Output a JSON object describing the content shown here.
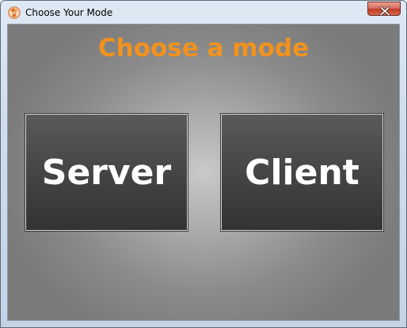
{
  "window": {
    "title": "Choose Your Mode",
    "app_icon": "radiation-icon",
    "close_icon": "close-icon"
  },
  "main": {
    "heading": "Choose a mode",
    "buttons": [
      {
        "label": "Server"
      },
      {
        "label": "Client"
      }
    ]
  },
  "colors": {
    "heading": "#f2921f",
    "button_text": "#ffffff",
    "close_button": "#c13c25"
  }
}
